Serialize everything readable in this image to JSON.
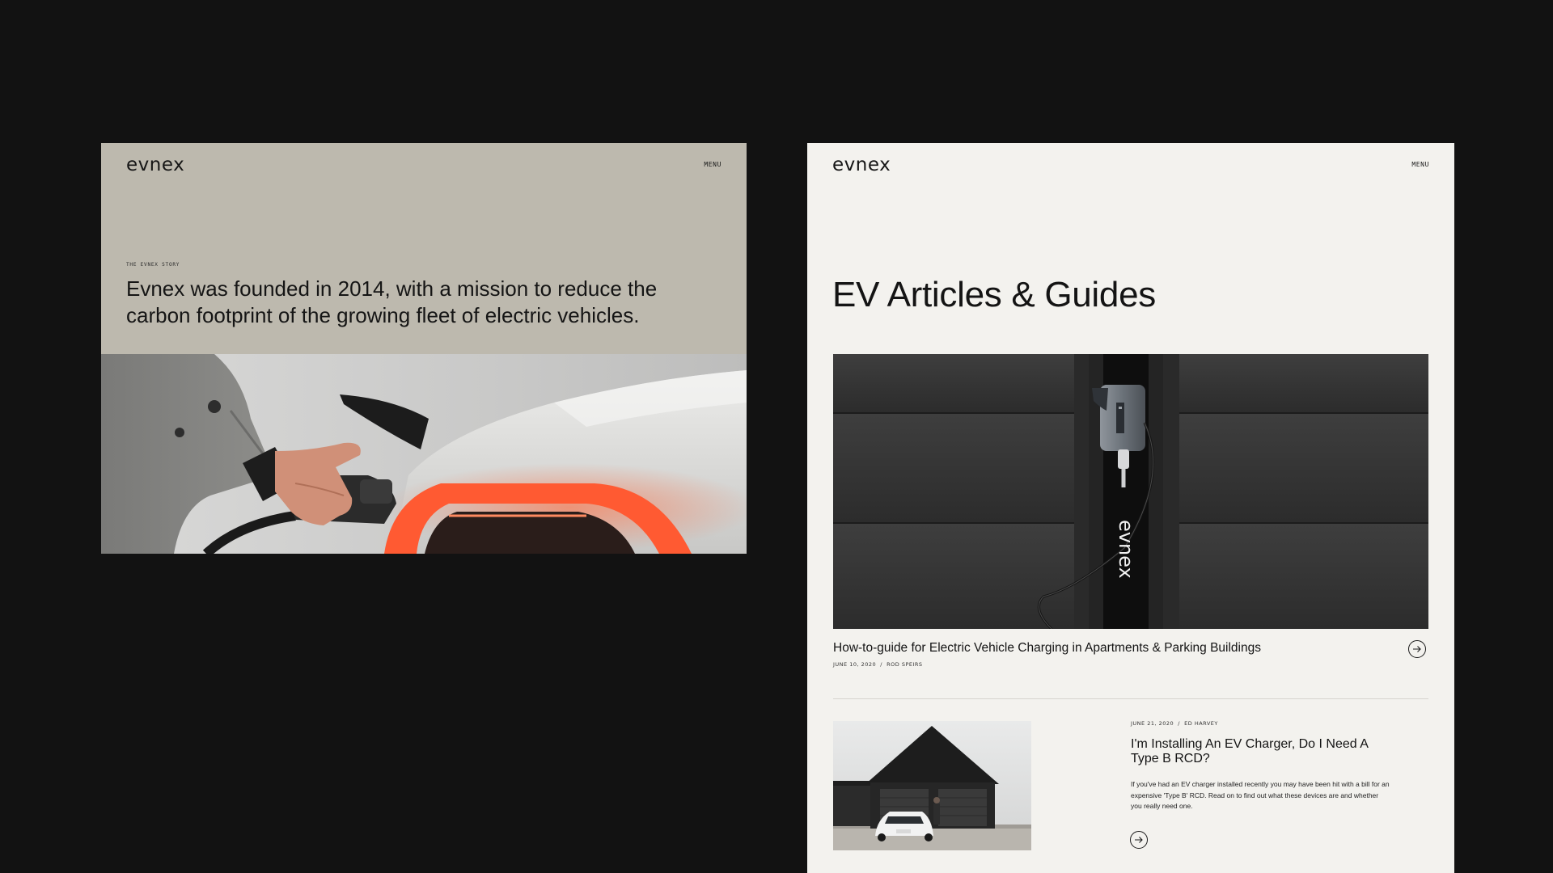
{
  "left_page": {
    "logo": "evnex",
    "menu_label": "MENU",
    "eyebrow": "THE EVNEX STORY",
    "story_text": "Evnex was founded in 2014, with a mission to reduce the carbon footprint of the growing fleet of electric vehicles.",
    "background_color": "#bdb9ae"
  },
  "right_page": {
    "logo": "evnex",
    "menu_label": "MENU",
    "page_title": "EV Articles & Guides",
    "wall_brand": "evnex",
    "featured_article": {
      "title": "How-to-guide for Electric Vehicle Charging in Apartments & Parking Buildings",
      "date": "JUNE 10, 2020",
      "separator": "/",
      "author": "ROD SPEIRS"
    },
    "article_card": {
      "date": "JUNE 21, 2020",
      "separator": "/",
      "author": "ED HARVEY",
      "title": "I'm Installing An EV Charger, Do I Need A Type B RCD?",
      "excerpt": "If you've had an EV charger installed recently you may have been hit with a bill for an expensive 'Type B' RCD. Read on to find out what these devices are and whether you really need one."
    },
    "background_color": "#f3f2ee"
  },
  "icons": {
    "arrow": "arrow-right-circle-icon"
  },
  "colors": {
    "canvas": "#121212",
    "text": "#141414",
    "tail_light": "#ff5a32"
  }
}
